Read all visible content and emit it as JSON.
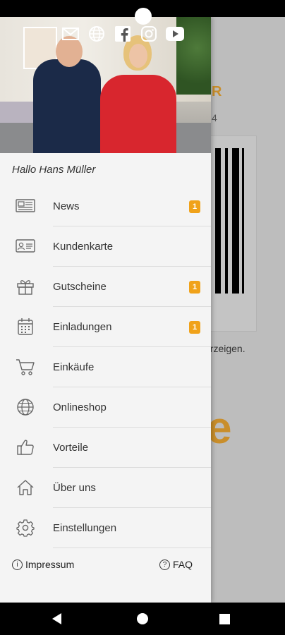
{
  "background_app": {
    "heading_fragment": "R",
    "sub_fragment": "4",
    "hint_fragment": "orzeigen.",
    "big_fragment": "e"
  },
  "drawer": {
    "social_icons": [
      "mail-icon",
      "globe-icon",
      "facebook-icon",
      "instagram-icon",
      "youtube-icon"
    ],
    "greeting": "Hallo Hans Müller",
    "menu_items": [
      {
        "label": "News",
        "icon": "newspaper-icon",
        "badge": "1"
      },
      {
        "label": "Kundenkarte",
        "icon": "id-card-icon",
        "badge": ""
      },
      {
        "label": "Gutscheine",
        "icon": "gift-icon",
        "badge": "1"
      },
      {
        "label": "Einladungen",
        "icon": "calendar-icon",
        "badge": "1"
      },
      {
        "label": "Einkäufe",
        "icon": "cart-icon",
        "badge": ""
      },
      {
        "label": "Onlineshop",
        "icon": "globe-icon",
        "badge": ""
      },
      {
        "label": "Vorteile",
        "icon": "thumbs-up-icon",
        "badge": ""
      },
      {
        "label": "Über uns",
        "icon": "home-icon",
        "badge": ""
      },
      {
        "label": "Einstellungen",
        "icon": "gear-icon",
        "badge": ""
      }
    ],
    "footer": {
      "impressum": "Impressum",
      "impressum_icon": "i",
      "faq": "FAQ",
      "faq_icon": "?"
    }
  },
  "colors": {
    "accent": "#f0a21a",
    "background_accent": "#c98e2b"
  }
}
